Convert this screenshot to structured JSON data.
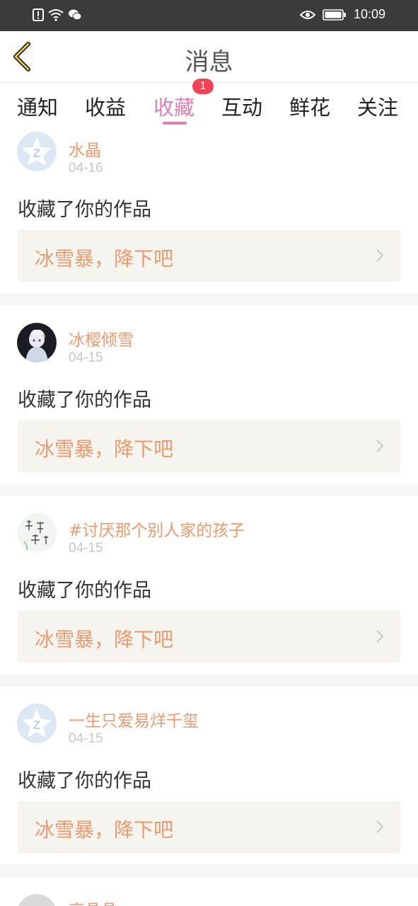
{
  "status_bar": {
    "time": "10:09"
  },
  "header": {
    "title": "消息"
  },
  "tabs": [
    {
      "label": "通知"
    },
    {
      "label": "收益"
    },
    {
      "label": "收藏",
      "badge": "1"
    },
    {
      "label": "互动"
    },
    {
      "label": "鲜花"
    },
    {
      "label": "关注"
    }
  ],
  "active_tab": "收藏",
  "colors": {
    "accent_pink": "#e07fb0",
    "accent_orange": "#ee9a6e",
    "badge_red": "#f04454"
  },
  "feed": [
    {
      "user": "水晶",
      "date": "04-16",
      "action": "收藏了你的作品",
      "work_title": "冰雪暴，降下吧"
    },
    {
      "user": "冰樱倾雪",
      "date": "04-15",
      "action": "收藏了你的作品",
      "work_title": "冰雪暴，降下吧"
    },
    {
      "user": "#讨厌那个别人家的孩子",
      "date": "04-15",
      "action": "收藏了你的作品",
      "work_title": "冰雪暴，降下吧"
    },
    {
      "user": "一生只爱易烊千玺",
      "date": "04-15",
      "action": "收藏了你的作品",
      "work_title": "冰雪暴，降下吧"
    },
    {
      "user": "亮晶晶"
    }
  ]
}
